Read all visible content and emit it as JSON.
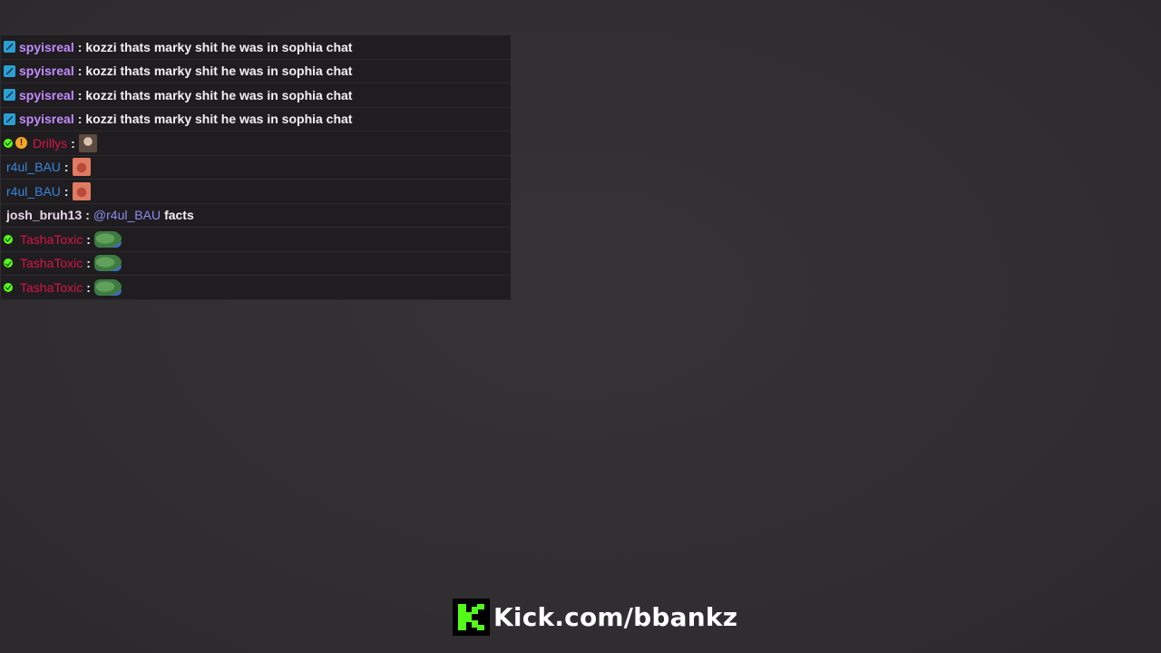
{
  "colors": {
    "background": "#302e30",
    "row_background": "#1f1d1f",
    "kick_green": "#53fc18",
    "subscriber_badge": "#2a9fd6",
    "mention": "#8f8cf5"
  },
  "chat": {
    "messages": [
      {
        "user": "spyisreal",
        "user_color": "#c38cff",
        "badges": [
          "subscriber-icon"
        ],
        "separator": ":",
        "text": "kozzi thats marky shit he was in sophia chat"
      },
      {
        "user": "spyisreal",
        "user_color": "#c38cff",
        "badges": [
          "subscriber-icon"
        ],
        "separator": ":",
        "text": "kozzi thats marky shit he was in sophia chat"
      },
      {
        "user": "spyisreal",
        "user_color": "#c38cff",
        "badges": [
          "subscriber-icon"
        ],
        "separator": ":",
        "text": "kozzi thats marky shit he was in sophia chat"
      },
      {
        "user": "spyisreal",
        "user_color": "#c38cff",
        "badges": [
          "subscriber-icon"
        ],
        "separator": ":",
        "text": "kozzi thats marky shit he was in sophia chat"
      },
      {
        "user": "Drillys",
        "user_color": "#d6154a",
        "badges": [
          "verified-icon",
          "warning-icon"
        ],
        "separator": ":",
        "emote": "face-emote"
      },
      {
        "user": "r4ul_BAU",
        "user_color": "#3b86e0",
        "badges": [],
        "separator": ":",
        "emote": "red-face-emote"
      },
      {
        "user": "r4ul_BAU",
        "user_color": "#3b86e0",
        "badges": [],
        "separator": ":",
        "emote": "red-face-emote"
      },
      {
        "user": "josh_bruh13",
        "user_color": "#e8d7e8",
        "badges": [],
        "separator": ":",
        "mention": "@r4ul_BAU",
        "text": "facts"
      },
      {
        "user": "TashaToxic",
        "user_color": "#d6154a",
        "badges": [
          "verified-icon"
        ],
        "separator": ":",
        "emote": "pepe-emote"
      },
      {
        "user": "TashaToxic",
        "user_color": "#d6154a",
        "badges": [
          "verified-icon"
        ],
        "separator": ":",
        "emote": "pepe-emote"
      },
      {
        "user": "TashaToxic",
        "user_color": "#d6154a",
        "badges": [
          "verified-icon"
        ],
        "separator": ":",
        "emote": "pepe-emote"
      }
    ]
  },
  "brand": {
    "logo_icon": "kick-logo-icon",
    "text": "Kick.com/bbankz"
  }
}
